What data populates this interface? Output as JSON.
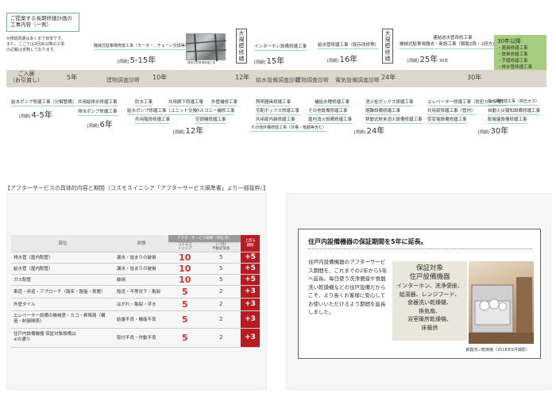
{
  "top": {
    "intro_title": "ご提案する長期修繕計画の\n工事内容（一例）",
    "note": "※修繕周期はあくまで目安です。\nまた、ここでは2回目以降の工事\nの記載は省略しております。",
    "photo_caption": "機械式駐車場修繕工事",
    "major_repair_label": "大規模修繕",
    "start_label": "ご入居\n（お引渡し）",
    "milestones": [
      "5年",
      "10年",
      "12年",
      "24年",
      "30年"
    ],
    "phases": [
      "建物調査診断",
      "給水設備調査診断",
      "建物調査診断",
      "電気設備調査診断",
      "建物調査診断"
    ],
    "above": [
      {
        "work": "機械式駐車場修繕工事（モーター、チェーン交換等）",
        "label": "[周期]",
        "cycle": "5-15年"
      },
      {
        "work": "インターホン設備修繕工事",
        "label": "[周期]",
        "cycle": "15年"
      },
      {
        "work": "給水管修繕工事（既存改修等）",
        "label": "[周期]",
        "cycle": "16年"
      },
      {
        "work": "連結送水管改修工事\n機械式駐車場撤去・新設工事（鋼製2段・1段方式等）",
        "label": "[周期]",
        "cycle": "25年",
        "cycle2": "30年"
      }
    ],
    "after30": [
      "30年以降",
      "・避具修繕工事",
      "・鉄骨修繕工事",
      "・手摺修繕工事",
      "・排水管修繕工事",
      "等"
    ],
    "below": [
      {
        "works": [
          "給水ポンプ修繕工事（分解整備）"
        ],
        "label": "[周期]",
        "cycle": "4-5年"
      },
      {
        "works": [
          "共用給排水修繕工事",
          "排水ポンプ修繕工事"
        ],
        "label": "[周期]",
        "cycle": "6年"
      },
      {
        "works": [
          "防水工事",
          "共用廊下修繕工事",
          "外壁補修工事",
          "給水ポンプ修繕工事（ユニット交換）",
          "バルコニー補修工事",
          "共用階段修繕工事",
          "空調機修繕工事"
        ],
        "label": "[周期]",
        "cycle": "12年"
      },
      {
        "works": [
          "照明器具修繕工事",
          "宅配ボックス修繕工事",
          "共用部内装修繕工事",
          "その他外構修繕工事（外構・植栽等含む）",
          "補給水槽修繕工事",
          "その他設備修繕工事",
          "屋内消火設備修繕工事",
          "消火栓ボックス修繕工事",
          "避難設備修繕工事",
          "移動式粉末消火設備修繕工事"
        ],
        "label": "[周期]",
        "cycle": "24年"
      },
      {
        "works": [
          "エレベーター修繕工事（防犯カメラ等）",
          "共用部修繕工事（管内）",
          "受変電設備修繕工事",
          "受水槽修繕工事（高圧ガス）",
          "自動火災報知設備修繕工事",
          "配電盤設備修繕工事"
        ],
        "label": "[周期]",
        "cycle": "30年"
      }
    ]
  },
  "section_title": "【アフターサービスの具体的内容と期間（コスモスイニシア「アフターサービス規準書」より一部抜粋）】",
  "table": {
    "head_period": "アフターサービス期間（単位:年）",
    "col_part": "部位",
    "col_state": "状態",
    "col_cosmos": "コスモス\nイニシア",
    "col_general": "(一社)\n不動産協会",
    "col_diff": "上回る\n期間",
    "rows": [
      {
        "part": "排水管（屋内配管）",
        "state": "漏水・詰まりの破損",
        "cosmos": "10",
        "general": "5",
        "diff": "+5"
      },
      {
        "part": "給水管（屋内配管）",
        "state": "漏水・詰まりの破損",
        "cosmos": "10",
        "general": "5",
        "diff": "+5"
      },
      {
        "part": "ガス配管",
        "state": "破損",
        "cosmos": "10",
        "general": "5",
        "diff": "+5"
      },
      {
        "part": "車道・歩道・アプローチ（路床・路盤・表層）",
        "state": "陥没・不等沈下・亀裂",
        "cosmos": "5",
        "general": "2",
        "diff": "+3"
      },
      {
        "part": "外壁タイル",
        "state": "はがれ・亀裂・浮き",
        "cosmos": "5",
        "general": "2",
        "diff": "+3"
      },
      {
        "part": "エレベーター設備の機械室・カゴ・昇降路（構造・制御関係）",
        "state": "結露不良・機能不良",
        "cosmos": "5",
        "general": "2",
        "diff": "+3"
      },
      {
        "part": "住戸内設備機器 保証対象設備は\n※の通り",
        "state": "取付不良・作動不良",
        "cosmos": "5",
        "general": "2",
        "diff": "+3"
      }
    ]
  },
  "warranty": {
    "heading": "住戸内設備機器の保証期間を5年に延長。",
    "body": "住戸内設備機器のアフターサービス期間を、これまでの2年から5年へ延長。毎日使う洗浄便座や食器洗い乾燥機などの住戸設備だからこそ、より長くお客様に安心してお使いいただけるよう期間を延長しました。",
    "target_title": "保証対象\n住戸設備機器",
    "targets": [
      "インターホン、洗浄便座、",
      "給湯器、レンジフード、",
      "食器洗い乾燥機、",
      "換気扇、",
      "浴室暖房乾燥機、",
      "床暖房"
    ],
    "photo_caption": "食器洗い乾燥機（2018年6月撮影）"
  }
}
